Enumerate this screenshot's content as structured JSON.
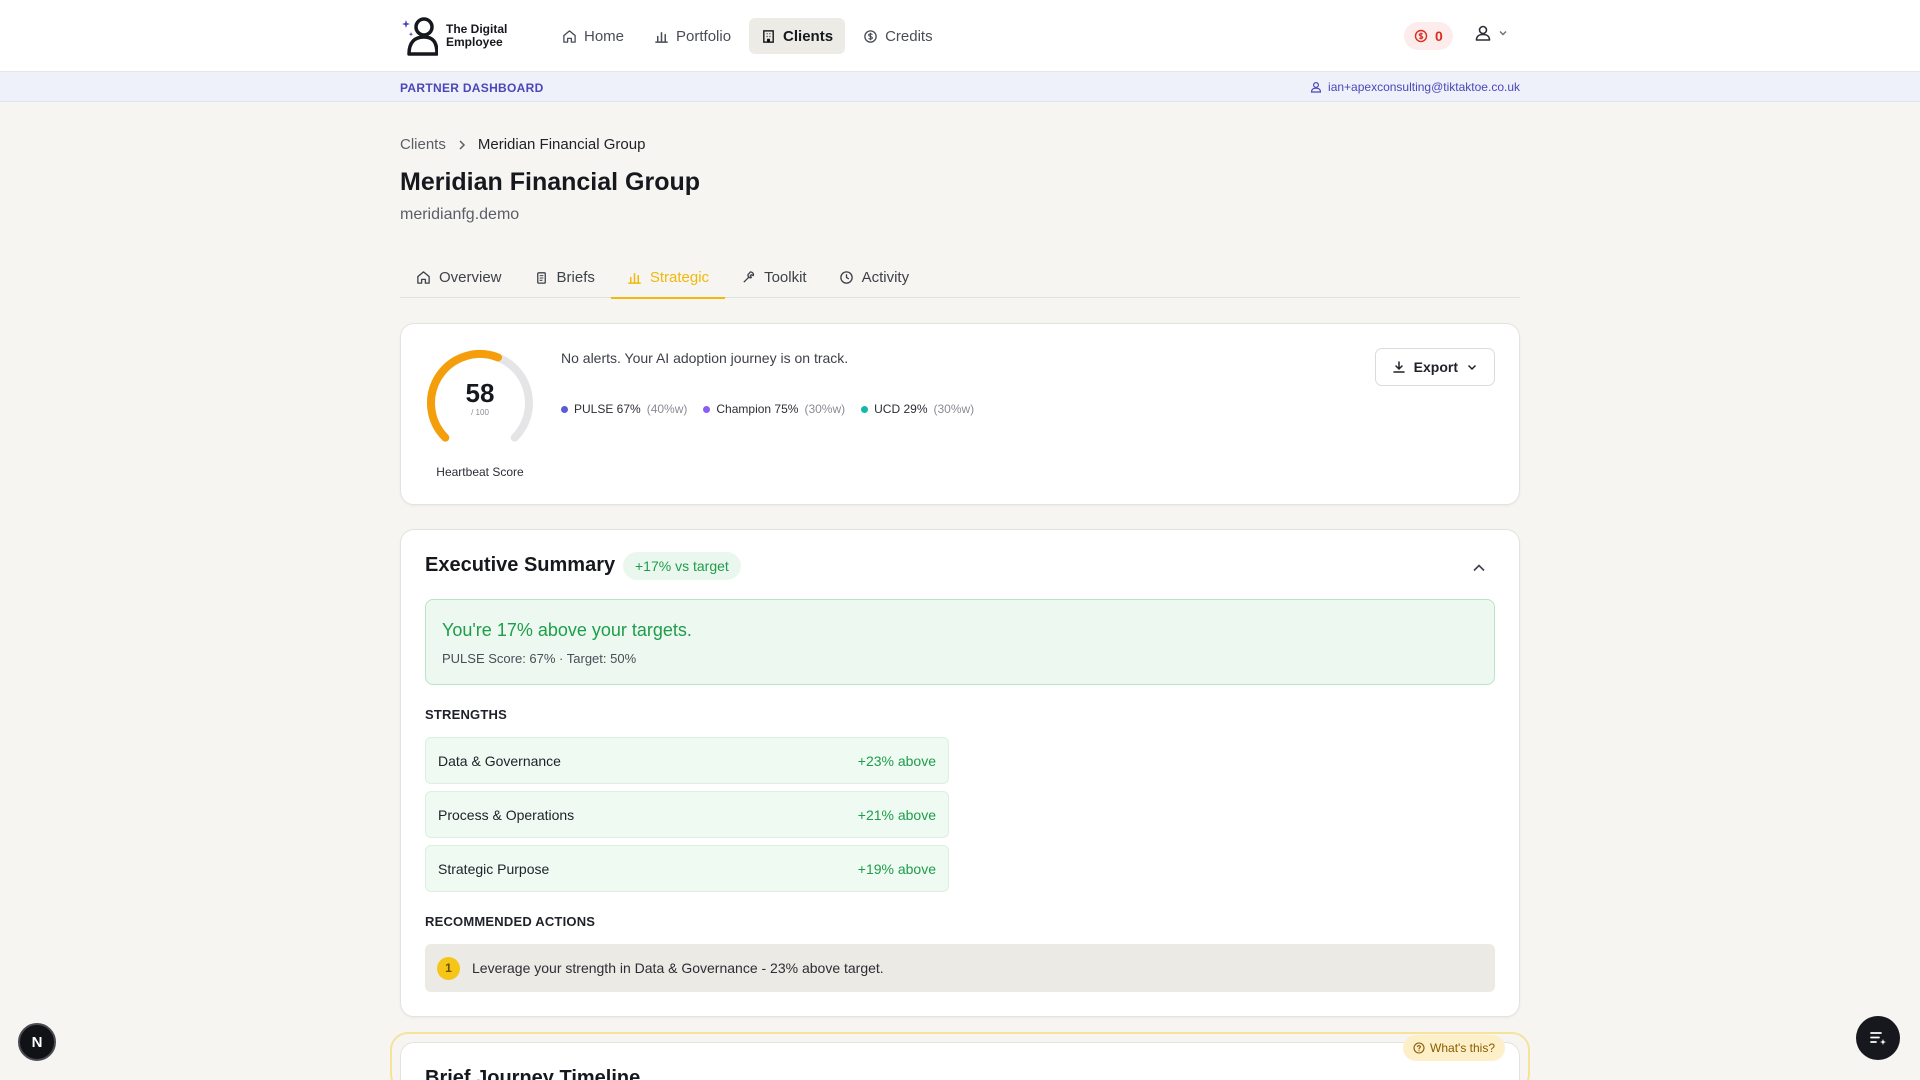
{
  "brand": {
    "line1": "The Digital",
    "line2": "Employee"
  },
  "nav": {
    "home": "Home",
    "portfolio": "Portfolio",
    "clients": "Clients",
    "credits": "Credits",
    "credit_count": "0"
  },
  "partner_bar": {
    "label": "PARTNER DASHBOARD",
    "email": "ian+apexconsulting@tiktaktoe.co.uk"
  },
  "breadcrumb": {
    "parent": "Clients",
    "current": "Meridian Financial Group"
  },
  "page": {
    "title": "Meridian Financial Group",
    "subtitle": "meridianfg.demo"
  },
  "tabs": {
    "overview": "Overview",
    "briefs": "Briefs",
    "strategic": "Strategic",
    "toolkit": "Toolkit",
    "activity": "Activity"
  },
  "heartbeat": {
    "score": "58",
    "max": "/ 100",
    "score_value": 58,
    "label": "Heartbeat Score",
    "alert": "No alerts. Your AI adoption journey is on track.",
    "metrics": [
      {
        "name": "PULSE 67%",
        "weight": "(40%w)",
        "color": "#5b5bd6"
      },
      {
        "name": "Champion 75%",
        "weight": "(30%w)",
        "color": "#8b5cf6"
      },
      {
        "name": "UCD 29%",
        "weight": "(30%w)",
        "color": "#14b8a6"
      }
    ],
    "export_label": "Export",
    "gauge_color": "#f59e0b"
  },
  "executive_summary": {
    "title": "Executive Summary",
    "badge": "+17% vs target",
    "headline": "You're 17% above your targets.",
    "detail": "PULSE Score: 67% · Target: 50%",
    "strengths_label": "STRENGTHS",
    "strengths": [
      {
        "name": "Data & Governance",
        "value": "+23% above"
      },
      {
        "name": "Process & Operations",
        "value": "+21% above"
      },
      {
        "name": "Strategic Purpose",
        "value": "+19% above"
      }
    ],
    "actions_label": "RECOMMENDED ACTIONS",
    "actions": [
      {
        "num": "1",
        "text": "Leverage your strength in Data & Governance - 23% above target."
      }
    ]
  },
  "timeline": {
    "title": "Brief Journey Timeline",
    "help": "What's this?"
  },
  "dev_badge": "N"
}
